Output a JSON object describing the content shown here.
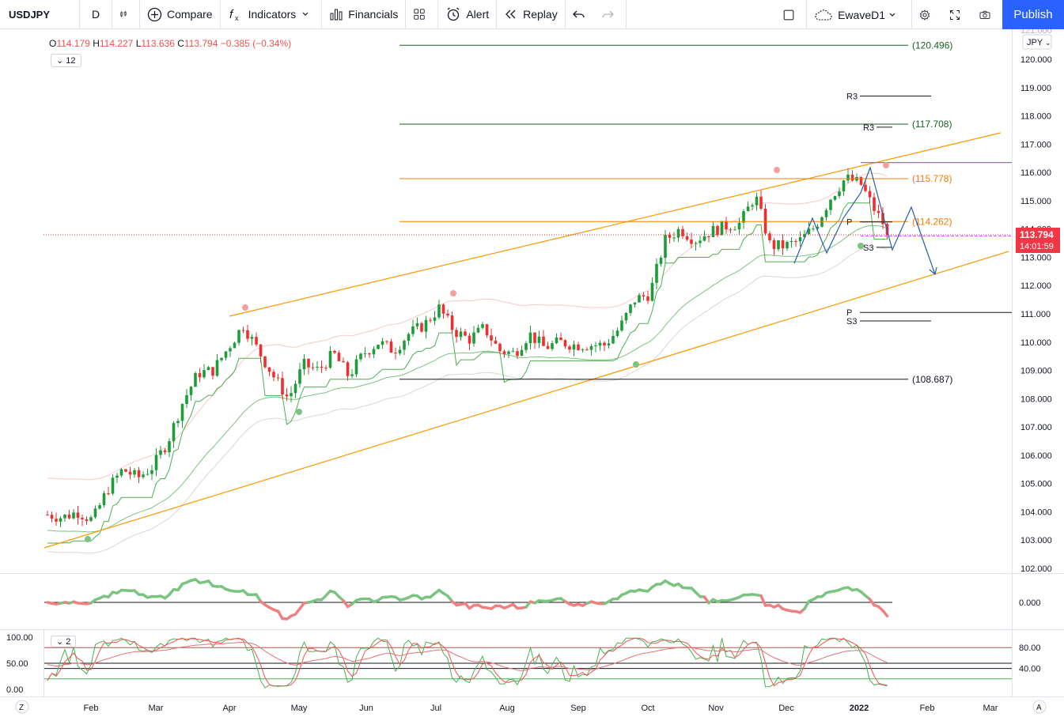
{
  "toolbar": {
    "symbol": "USDJPY",
    "interval": "D",
    "compare": "Compare",
    "indicators": "Indicators",
    "financials": "Financials",
    "alert": "Alert",
    "replay": "Replay",
    "layout_name": "EwaveD1",
    "publish": "Publish"
  },
  "legend": {
    "open_label": "O",
    "open": "114.179",
    "high_label": "H",
    "high": "114.227",
    "low_label": "L",
    "low": "113.636",
    "close_label": "C",
    "close": "113.794",
    "change": "−0.385 (−0.34%)",
    "collapse_count": "12",
    "collapse_count_osc": "2"
  },
  "price_scale": {
    "currency": "JPY",
    "top_partial": "121.000",
    "last_price": "113.794",
    "countdown": "14:01:59"
  },
  "bottom_bar": {
    "left": "Z",
    "right": "A"
  },
  "colors": {
    "up": "#089981",
    "down": "#f23645",
    "bull_green": "#26a69a",
    "candle_up": "#1e9c3a",
    "candle_down": "#ef2f2f",
    "accent": "#2962ff",
    "channel": "#ff9800",
    "magenta": "#e040fb",
    "forecast": "#2a5db0"
  },
  "chart_data": {
    "type": "candlestick",
    "symbol": "USDJPY",
    "timeframe": "D",
    "x_ticks": [
      "Feb",
      "Mar",
      "Apr",
      "May",
      "Jun",
      "Jul",
      "Aug",
      "Sep",
      "Oct",
      "Nov",
      "Dec",
      "2022",
      "Feb",
      "Mar"
    ],
    "y_ticks": [
      "120.000",
      "119.000",
      "118.000",
      "117.000",
      "116.000",
      "115.000",
      "114.000",
      "113.000",
      "112.000",
      "111.000",
      "110.000",
      "109.000",
      "108.000",
      "107.000",
      "106.000",
      "105.000",
      "104.000",
      "103.000",
      "102.000"
    ],
    "ylim": [
      102.0,
      121.0
    ],
    "horizontal_levels": [
      {
        "label": "(120.496)",
        "value": 120.496
      },
      {
        "label": "(117.708)",
        "value": 117.708
      },
      {
        "label": "(115.778)",
        "value": 115.778
      },
      {
        "label": "(114.262)",
        "value": 114.262
      },
      {
        "label": "(108.687)",
        "value": 108.687
      }
    ],
    "pivot_labels": [
      {
        "label": "R3",
        "value": 118.7
      },
      {
        "label": "R3",
        "value": 117.6
      },
      {
        "label": "P",
        "value": 114.25
      },
      {
        "label": "S3",
        "value": 113.35
      },
      {
        "label": "P",
        "value": 111.05
      },
      {
        "label": "S3",
        "value": 110.75
      }
    ],
    "close_path": [
      [
        "Jan 4",
        103.9
      ],
      [
        "Jan 11",
        103.8
      ],
      [
        "Jan 18",
        104.0
      ],
      [
        "Jan 25",
        103.7
      ],
      [
        "Feb 1",
        104.8
      ],
      [
        "Feb 8",
        105.5
      ],
      [
        "Feb 15",
        105.2
      ],
      [
        "Feb 22",
        105.6
      ],
      [
        "Mar 1",
        106.5
      ],
      [
        "Mar 8",
        107.9
      ],
      [
        "Mar 15",
        108.9
      ],
      [
        "Mar 22",
        109.0
      ],
      [
        "Mar 29",
        109.8
      ],
      [
        "Apr 1",
        110.6
      ],
      [
        "Apr 8",
        109.7
      ],
      [
        "Apr 15",
        108.8
      ],
      [
        "Apr 22",
        108.0
      ],
      [
        "Apr 29",
        109.2
      ],
      [
        "May 6",
        109.0
      ],
      [
        "May 13",
        109.6
      ],
      [
        "May 20",
        108.8
      ],
      [
        "May 27",
        109.6
      ],
      [
        "Jun 3",
        110.0
      ],
      [
        "Jun 10",
        109.7
      ],
      [
        "Jun 17",
        110.3
      ],
      [
        "Jun 24",
        110.6
      ],
      [
        "Jul 1",
        111.2
      ],
      [
        "Jul 8",
        110.4
      ],
      [
        "Jul 15",
        110.1
      ],
      [
        "Jul 22",
        110.5
      ],
      [
        "Jul 29",
        109.7
      ],
      [
        "Aug 5",
        109.6
      ],
      [
        "Aug 12",
        110.3
      ],
      [
        "Aug 19",
        109.8
      ],
      [
        "Aug 26",
        110.0
      ],
      [
        "Sep 2",
        109.9
      ],
      [
        "Sep 9",
        109.9
      ],
      [
        "Sep 16",
        109.9
      ],
      [
        "Sep 23",
        110.5
      ],
      [
        "Sep 30",
        111.5
      ],
      [
        "Oct 7",
        111.7
      ],
      [
        "Oct 14",
        113.6
      ],
      [
        "Oct 21",
        114.0
      ],
      [
        "Oct 28",
        113.6
      ],
      [
        "Nov 4",
        113.9
      ],
      [
        "Nov 11",
        114.1
      ],
      [
        "Nov 18",
        114.2
      ],
      [
        "Nov 24",
        115.2
      ],
      [
        "Nov 29",
        113.4
      ],
      [
        "Dec 6",
        113.4
      ],
      [
        "Dec 13",
        113.6
      ],
      [
        "Dec 20",
        114.1
      ],
      [
        "Dec 27",
        115.1
      ],
      [
        "Jan 3",
        115.8
      ],
      [
        "Jan 7",
        115.6
      ],
      [
        "Jan 12",
        114.6
      ],
      [
        "Jan 14",
        113.8
      ]
    ],
    "oscillator_1": {
      "zero_label": "0.000"
    },
    "oscillator_2": {
      "left_ticks": [
        "100.00",
        "50.00",
        "0.00"
      ],
      "right_ticks": [
        "80.00",
        "40.00"
      ]
    }
  }
}
